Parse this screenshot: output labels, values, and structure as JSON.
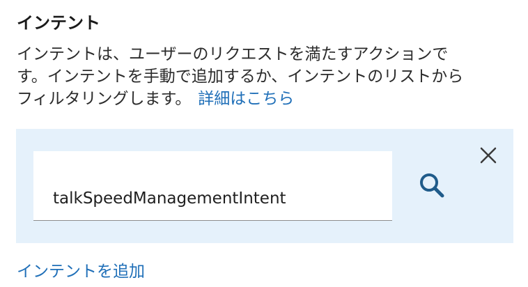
{
  "intent_section": {
    "title": "インテント",
    "description_lines": [
      "インテントは、ユーザーのリクエストを満たすアクションで",
      "す。インテントを手動で追加するか、インテントのリストから",
      "フィルタリングします。"
    ],
    "learn_more_label": "詳細はこちら"
  },
  "search": {
    "value": "talkSpeedManagementIntent",
    "search_icon": "search-icon",
    "close_icon": "close-icon"
  },
  "actions": {
    "add_intent_label": "インテントを追加"
  },
  "colors": {
    "link": "#1f6fb8",
    "panel_bg": "#e5f1fb",
    "search_icon": "#1f5b8a"
  }
}
